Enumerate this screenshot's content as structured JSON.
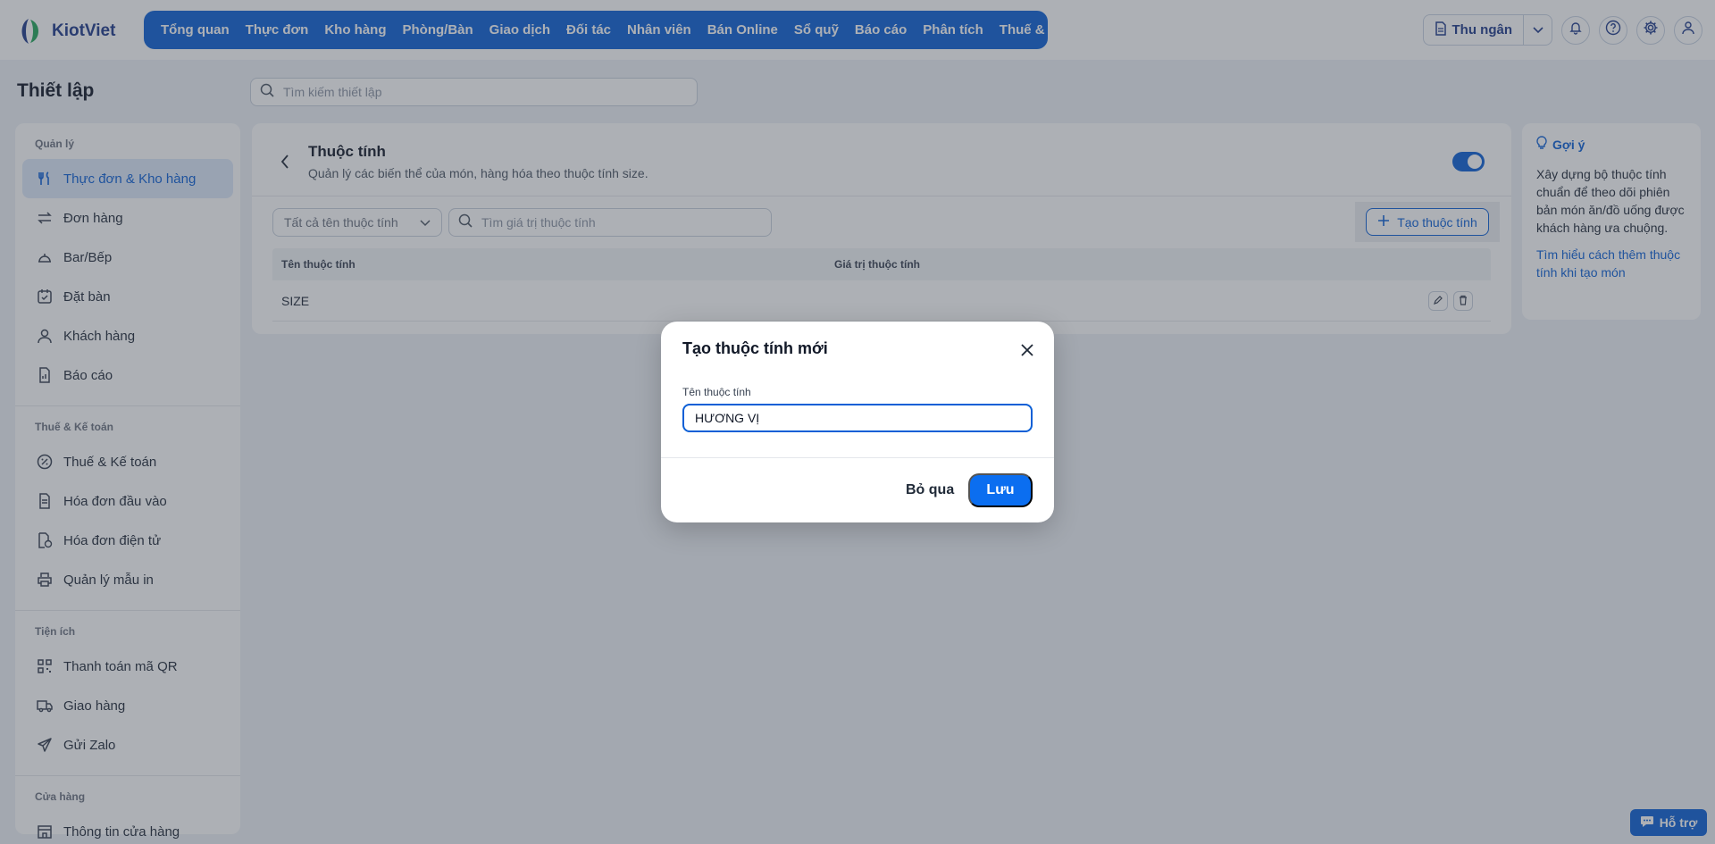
{
  "app": {
    "name": "KiotViet"
  },
  "nav": {
    "items": [
      "Tổng quan",
      "Thực đơn",
      "Kho hàng",
      "Phòng/Bàn",
      "Giao dịch",
      "Đối tác",
      "Nhân viên",
      "Bán Online",
      "Sổ quỹ",
      "Báo cáo",
      "Phân tích",
      "Thuế & Kế toán"
    ]
  },
  "topRight": {
    "cashier_label": "Thu ngân"
  },
  "page": {
    "title": "Thiết lập",
    "search_placeholder": "Tìm kiếm thiết lập"
  },
  "sidebar": {
    "groups": [
      {
        "title": "Quản lý",
        "items": [
          "Thực đơn & Kho hàng",
          "Đơn hàng",
          "Bar/Bếp",
          "Đặt bàn",
          "Khách hàng",
          "Báo cáo"
        ]
      },
      {
        "title": "Thuế & Kế toán",
        "items": [
          "Thuế & Kế toán",
          "Hóa đơn đầu vào",
          "Hóa đơn điện tử",
          "Quản lý mẫu in"
        ]
      },
      {
        "title": "Tiện ích",
        "items": [
          "Thanh toán mã QR",
          "Giao hàng",
          "Gửi Zalo"
        ]
      },
      {
        "title": "Cửa hàng",
        "items": [
          "Thông tin cửa hàng"
        ]
      }
    ]
  },
  "main": {
    "title": "Thuộc tính",
    "subtitle": "Quản lý các biến thể của món, hàng hóa theo thuộc tính size.",
    "filter_label": "Tất cả tên thuộc tính",
    "value_search_placeholder": "Tìm giá trị thuộc tính",
    "create_label": "Tạo thuộc tính",
    "table": {
      "col_name": "Tên thuộc tính",
      "col_value": "Giá trị thuộc tính",
      "rows": [
        {
          "name": "SIZE",
          "value": ""
        }
      ]
    }
  },
  "hint": {
    "title": "Gợi ý",
    "body": "Xây dựng bộ thuộc tính chuẩn để theo dõi phiên bản món ăn/đồ uống được khách hàng ưa chuộng.",
    "link": "Tìm hiểu cách thêm thuộc tính khi tạo món"
  },
  "help": {
    "label": "Hỗ trợ"
  },
  "modal": {
    "title": "Tạo thuộc tính mới",
    "field_label": "Tên thuộc tính",
    "field_value": "HƯƠNG VỊ",
    "cancel_label": "Bỏ qua",
    "save_label": "Lưu"
  },
  "colors": {
    "primary": "#0b5fd6",
    "active_bg": "#dde8fa",
    "overlay": "rgba(60,66,78,0.42)"
  },
  "icons": [
    "search-icon",
    "chevron-down-icon",
    "bell-icon",
    "help-icon",
    "gear-icon",
    "user-icon",
    "back-icon",
    "plus-icon",
    "edit-icon",
    "trash-icon",
    "lightbulb-icon",
    "close-icon",
    "chat-icon"
  ]
}
